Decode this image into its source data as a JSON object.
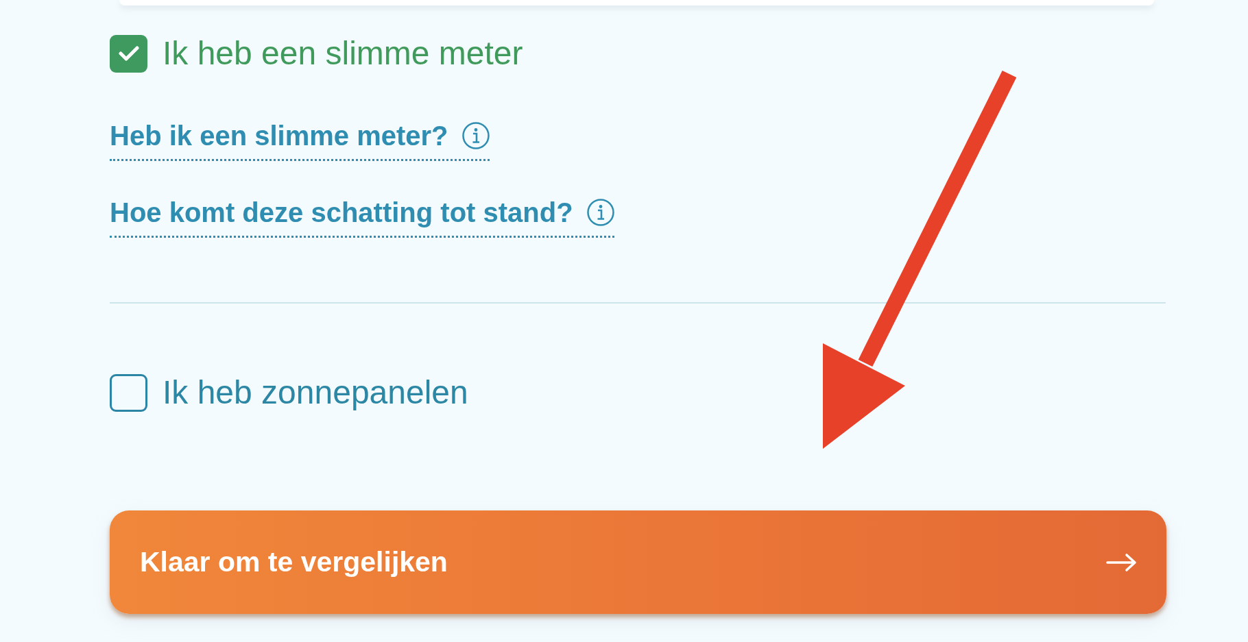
{
  "smart_meter": {
    "label": "Ik heb een slimme meter",
    "checked": true
  },
  "help_links": [
    {
      "label": "Heb ik een slimme meter?"
    },
    {
      "label": "Hoe komt deze schatting tot stand?"
    }
  ],
  "solar_panels": {
    "label": "Ik heb zonnepanelen",
    "checked": false
  },
  "submit_button": {
    "label": "Klaar om te vergelijken"
  }
}
